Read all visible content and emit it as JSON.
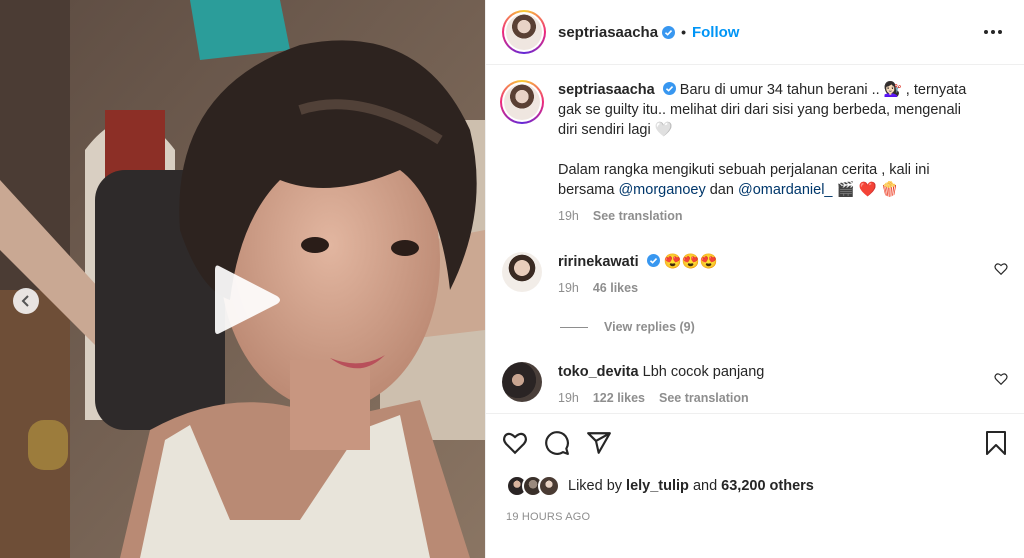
{
  "header": {
    "username": "septriasaacha",
    "separator": "•",
    "follow_label": "Follow"
  },
  "caption": {
    "username": "septriasaacha",
    "line1": "Baru di umur 34 tahun berani .. 💇🏻‍♀️ , ternyata gak se guilty itu.. melihat diri dari sisi yang berbeda, mengenali diri sendiri lagi 🤍",
    "line2_prefix": "Dalam rangka mengikuti sebuah perjalanan cerita , kali ini bersama ",
    "mention1": "@morganoey",
    "connector": " dan ",
    "mention2": "@omardaniel_",
    "emoji_end": " 🎬 ❤️ 🍿",
    "time": "19h",
    "see_translation": "See translation"
  },
  "comments": [
    {
      "username": "ririnekawati",
      "text": "😍😍😍",
      "time": "19h",
      "likes": "46 likes",
      "view_replies": "View replies (9)"
    },
    {
      "username": "toko_devita",
      "text": "Lbh cocok panjang",
      "time": "19h",
      "likes": "122 likes",
      "see_translation": "See translation"
    }
  ],
  "likes": {
    "prefix": "Liked by",
    "user": "lely_tulip",
    "connector": "and",
    "others": "63,200 others"
  },
  "timestamp": "19 HOURS AGO",
  "icons": {
    "verified": "verified-badge-icon",
    "more": "more-options-icon",
    "heart": "heart-icon",
    "comment": "comment-icon",
    "share": "share-icon",
    "save": "bookmark-icon",
    "play": "play-icon",
    "prev": "chevron-left-icon"
  },
  "colors": {
    "accent": "#0095f6",
    "mention": "#00376b",
    "muted": "#8e8e8e",
    "verified": "#3897f0"
  }
}
